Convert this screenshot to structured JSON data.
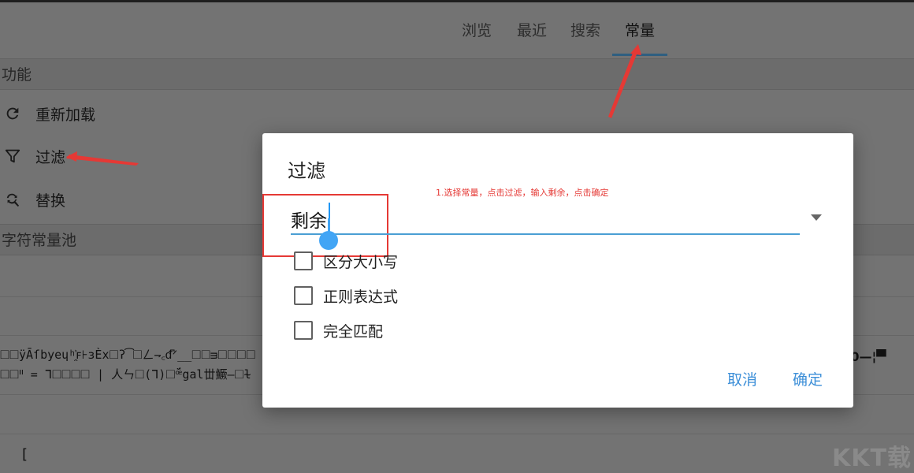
{
  "tabs": [
    {
      "label": "浏览",
      "active": false
    },
    {
      "label": "最近",
      "active": false
    },
    {
      "label": "搜索",
      "active": false
    },
    {
      "label": "常量",
      "active": true
    }
  ],
  "sections": {
    "functions_header": "功能",
    "pool_header": "字符常量池"
  },
  "menu": {
    "reload": {
      "label": "重新加载",
      "icon": "refresh-icon"
    },
    "filter": {
      "label": "过滤",
      "icon": "filter-icon"
    },
    "replace": {
      "label": "替换",
      "icon": "search-replace-icon"
    }
  },
  "background_rows": {
    "garbled_line_1": "🞎🞎ÿĀſbyeɥʰ̯͐ꜰ⊦ɜÈx🞎ʔ͡🞎ㄥ⇁꜀ᵭ͆ᐟ__🞎🞎ᴟ🞎🞎🞎🞎",
    "garbled_line_2": "🞎🞎ᐦ = ᒣ🞎🞎🞎🞎 | 人ㄣ🞎(ᒣ)🞎ꟹ̈́gal丗鱖—🞎ɫ",
    "right_garble": ")0—¦▀",
    "bracket": "["
  },
  "dialog": {
    "title": "过滤",
    "annotation": "1.选择常量，点击过滤，输入剩余，点击确定",
    "input_value": "剩余",
    "options": [
      {
        "label": "区分大小写",
        "checked": false
      },
      {
        "label": "正则表达式",
        "checked": false
      },
      {
        "label": "完全匹配",
        "checked": false
      }
    ],
    "cancel_label": "取消",
    "confirm_label": "确定"
  },
  "watermark": "KKT载",
  "colors": {
    "accent": "#3d8fd8",
    "annotation_red": "#e53935",
    "underline_blue": "#4a9fd4"
  }
}
